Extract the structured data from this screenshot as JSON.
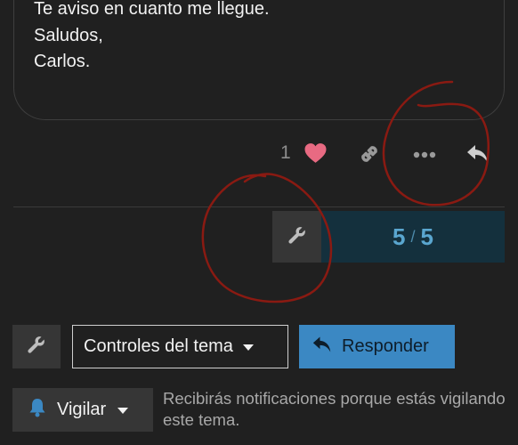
{
  "post": {
    "lines": [
      "Te aviso en cuanto me llegue.",
      "Saludos,",
      "Carlos."
    ]
  },
  "actions": {
    "like_count": "1",
    "icons": [
      "heart-icon",
      "link-icon",
      "more-icon",
      "reply-icon"
    ]
  },
  "progress": {
    "current": "5",
    "separator": "/",
    "total": "5"
  },
  "footer": {
    "topic_controls_label": "Controles del tema",
    "reply_label": "Responder",
    "watch_label": "Vigilar",
    "watch_description": "Recibirás notificaciones porque estás vigilando este tema."
  },
  "colors": {
    "background": "#202020",
    "accent": "#3b88c3",
    "heart": "#e86a82",
    "progress_bg": "#14303d",
    "annotation": "#8a1a12"
  }
}
